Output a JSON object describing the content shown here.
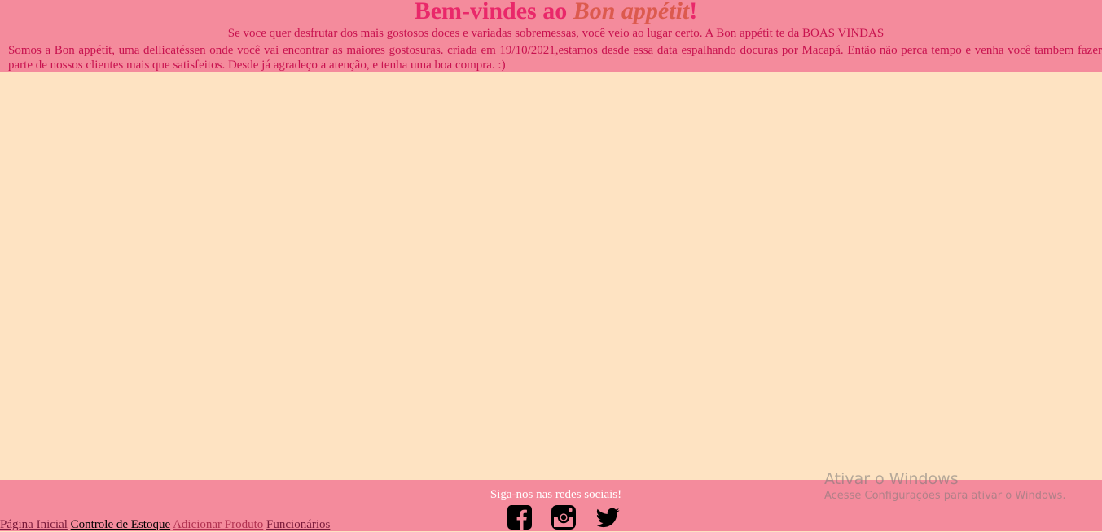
{
  "header": {
    "title_prefix": "Bem-vindes ao ",
    "title_brand": "Bon appétit",
    "title_suffix": "!",
    "subtitle": "Se voce quer desfrutar dos mais gostosos doces e variadas sobremessas, você veio ao lugar certo. A Bon appétit te da BOAS VINDAS",
    "about": "Somos a Bon appétit, uma dellicatéssen onde você vai encontrar as maiores gostosuras. criada em 19/10/2021,estamos desde essa data espalhando docuras por Macapá. Então não perca tempo e venha você tambem fazer parte de nossos clientes mais que satisfeitos. Desde já agradeço a atenção, e tenha uma boa compra. :)"
  },
  "footer": {
    "social_title": "Siga-nos nas redes sociais!",
    "social_icons": [
      "facebook-icon",
      "instagram-icon",
      "twitter-icon"
    ],
    "nav": [
      "Página Inicial",
      "Controle de Estoque",
      "Adicionar Produto",
      "Funcionários"
    ]
  },
  "watermark": {
    "line1": "Ativar o Windows",
    "line2": "Acesse Configurações para ativar o Windows."
  },
  "colors": {
    "header_bg": "#f48b9c",
    "page_bg": "#fee3c2",
    "title": "#e9286a",
    "brand": "#dc5a4e",
    "text": "#c8124f"
  }
}
